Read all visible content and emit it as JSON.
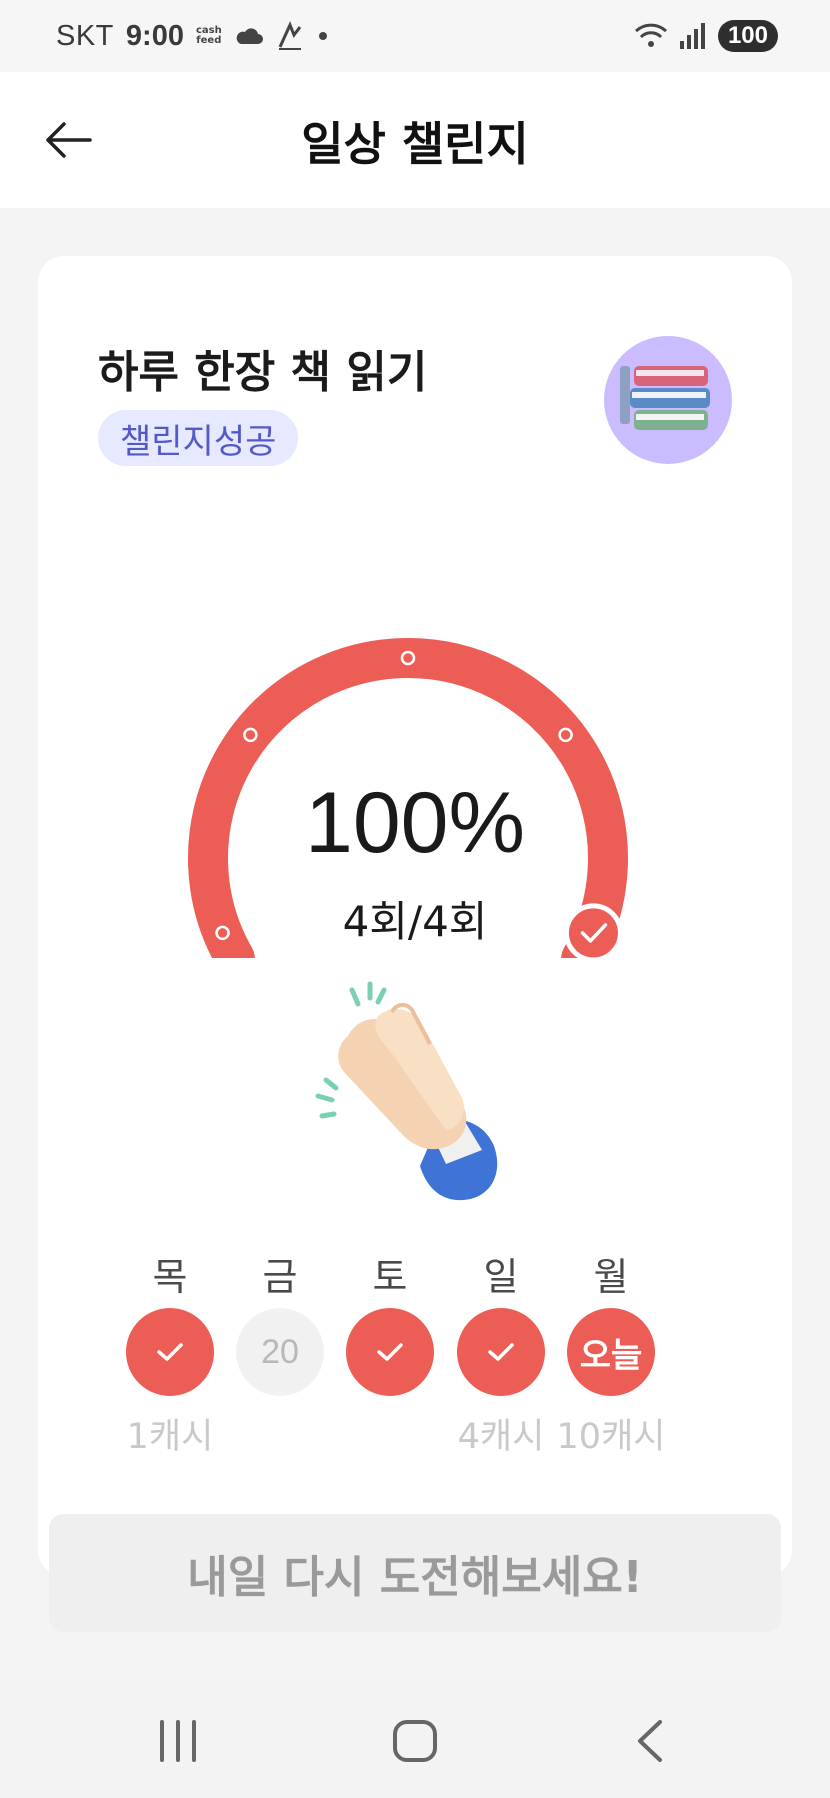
{
  "status_bar": {
    "carrier": "SKT",
    "time": "9:00",
    "app_label_top": "cash",
    "app_label_bottom": "feed",
    "battery": "100"
  },
  "header": {
    "title": "일상 챌린지",
    "back_icon": "arrow-left-icon"
  },
  "challenge": {
    "title": "하루 한장 책 읽기",
    "status_badge": "챌린지성공",
    "avatar_icon": "books-icon",
    "progress_percent_value": 100,
    "progress_percent": "100%",
    "count_text": "4회/4회",
    "celebration_icon": "clapping-hands-icon"
  },
  "week": [
    {
      "day": "목",
      "state": "done",
      "circle_text": "",
      "reward": "1캐시"
    },
    {
      "day": "금",
      "state": "missed",
      "circle_text": "20",
      "reward": ""
    },
    {
      "day": "토",
      "state": "done",
      "circle_text": "",
      "reward": ""
    },
    {
      "day": "일",
      "state": "done",
      "circle_text": "",
      "reward": "4캐시"
    },
    {
      "day": "월",
      "state": "today",
      "circle_text": "오늘",
      "reward": "10캐시"
    }
  ],
  "retry_button": "내일 다시 도전해보세요!",
  "colors": {
    "accent": "#ec5d56",
    "badge_bg": "#e6e9ff",
    "badge_text": "#5459c8"
  },
  "nav": {
    "recent_icon": "recent-apps-icon",
    "home_icon": "home-icon",
    "back_icon": "back-chevron-icon"
  }
}
